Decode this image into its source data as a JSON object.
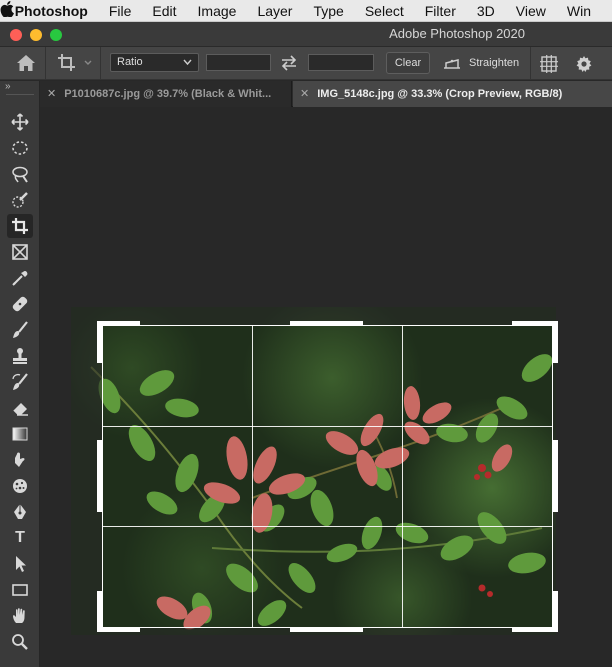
{
  "menubar": {
    "apple": "",
    "items": [
      "Photoshop",
      "File",
      "Edit",
      "Image",
      "Layer",
      "Type",
      "Select",
      "Filter",
      "3D",
      "View",
      "Win"
    ]
  },
  "window": {
    "title": "Adobe Photoshop 2020"
  },
  "options": {
    "ratio_label": "Ratio",
    "width_value": "",
    "height_value": "",
    "clear_label": "Clear",
    "straighten_label": "Straighten"
  },
  "tabs": [
    {
      "title": "P1010687c.jpg @ 39.7% (Black & Whit...",
      "active": false
    },
    {
      "title": "IMG_5148c.jpg @ 33.3% (Crop Preview, RGB/8)",
      "active": true
    }
  ],
  "tools": [
    "move-tool",
    "marquee-tool",
    "lasso-tool",
    "quick-select-tool",
    "crop-tool",
    "frame-tool",
    "eyedropper-tool",
    "healing-tool",
    "brush-tool",
    "stamp-tool",
    "history-brush-tool",
    "eraser-tool",
    "gradient-tool",
    "smudge-tool",
    "sponge-tool",
    "pen-tool",
    "type-tool",
    "path-select-tool",
    "shape-tool",
    "hand-tool",
    "zoom-tool"
  ],
  "colors": {
    "accent_leaf": "#c86a63",
    "green_leaf": "#5f9a3c",
    "panel": "#454545"
  }
}
